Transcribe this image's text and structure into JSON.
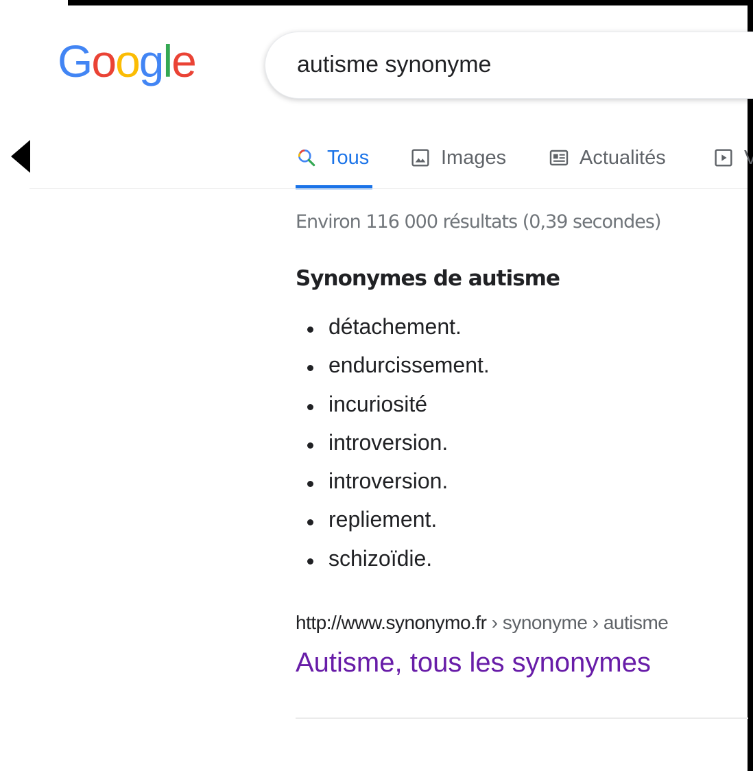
{
  "logo": {
    "letters": [
      "G",
      "o",
      "o",
      "g",
      "l",
      "e"
    ],
    "colors": [
      "#4285F4",
      "#EA4335",
      "#FBBC05",
      "#4285F4",
      "#34A853",
      "#EA4335"
    ]
  },
  "search": {
    "query": "autisme synonyme"
  },
  "tabs": [
    {
      "label": "Tous",
      "icon": "search-icon",
      "active": true
    },
    {
      "label": "Images",
      "icon": "image-icon",
      "active": false
    },
    {
      "label": "Actualités",
      "icon": "news-icon",
      "active": false
    },
    {
      "label": "V",
      "icon": "video-play-icon",
      "active": false
    }
  ],
  "results": {
    "stats": "Environ 116 000 résultats (0,39 secondes)"
  },
  "synonyms": {
    "heading": "Synonymes de autisme",
    "items": [
      "détachement.",
      "endurcissement.",
      "incuriosité",
      "introversion.",
      "introversion.",
      "repliement.",
      "schizoïdie."
    ]
  },
  "first_result": {
    "url_host": "http://www.synonymo.fr",
    "url_path": " › synonyme › autisme",
    "title": "Autisme, tous les synonymes"
  },
  "colors": {
    "link_visited": "#681da8",
    "tab_active": "#1a73e8",
    "text_muted": "#70757a"
  }
}
